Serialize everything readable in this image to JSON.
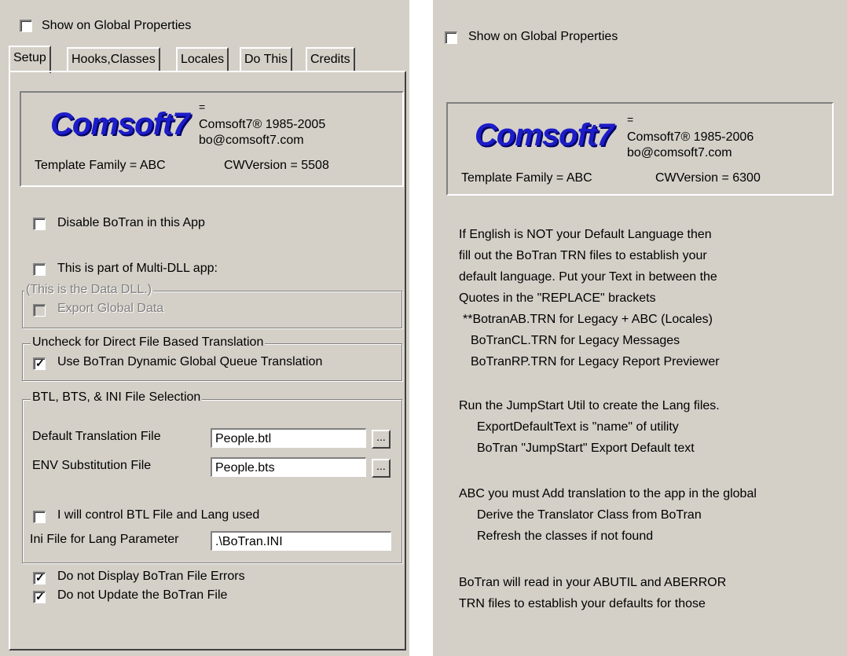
{
  "left": {
    "global_props_label": "Show on Global Properties",
    "tabs": [
      "Setup",
      "Hooks,Classes",
      "Locales",
      "Do This",
      "Credits"
    ],
    "about": {
      "logo": "Comsoft7",
      "eq": "=",
      "copyright": "Comsoft7® 1985-2005",
      "email": "bo@comsoft7.com",
      "template_family": "Template Family = ABC",
      "cw_version": "CWVersion = 5508"
    },
    "disable_label": "Disable BoTran in this App",
    "multidll_label": "This is part of Multi-DLL app:",
    "data_dll_group": "(This is the Data DLL.)",
    "export_label": "Export Global Data",
    "direct_group": "Uncheck for Direct File Based Translation",
    "dynamic_label": "Use BoTran Dynamic Global Queue Translation",
    "file_group": "BTL, BTS, & INI File Selection",
    "default_file_label": "Default Translation File",
    "default_file_value": "People.btl",
    "env_file_label": "ENV Substitution File",
    "env_file_value": "People.bts",
    "ellipsis": "...",
    "control_label": "I will control BTL File and Lang used",
    "ini_label": "Ini File for Lang Parameter",
    "ini_value": ".\\BoTran.INI",
    "no_display_errors_label": "Do not Display BoTran File Errors",
    "no_update_label": "Do not Update the BoTran File"
  },
  "right": {
    "global_props_label": "Show on Global Properties",
    "about": {
      "logo": "Comsoft7",
      "eq": "=",
      "copyright": "Comsoft7® 1985-2006",
      "email": "bo@comsoft7.com",
      "template_family": "Template Family = ABC",
      "cw_version": "CWVersion = 6300"
    },
    "text_lines": [
      "If English is NOT your Default Language then",
      "fill out the BoTran TRN files to establish your",
      "default language. Put your Text in between the",
      "Quotes in the \"REPLACE\" brackets",
      " **BotranAB.TRN for Legacy + ABC (Locales)",
      "   BoTranCL.TRN for Legacy Messages",
      "   BoTranRP.TRN for Legacy Report Previewer",
      "Run the JumpStart Util to create the Lang files.",
      "    ExportDefaultText is \"name\" of utility",
      "    BoTran \"JumpStart\" Export Default text",
      "ABC you must Add translation to the app in the global",
      "    Derive the Translator Class from BoTran",
      "    Refresh the classes if not found",
      "BoTran will read in your ABUTIL and ABERROR",
      "TRN files to establish your defaults for those"
    ]
  }
}
